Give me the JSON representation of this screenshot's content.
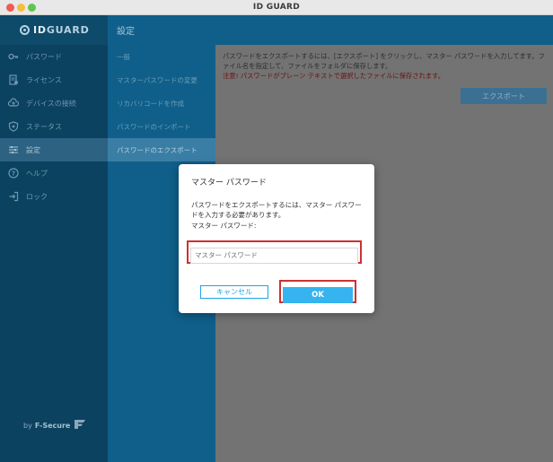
{
  "window": {
    "title": "ID GUARD"
  },
  "logo": {
    "id": "ID",
    "text": "GUARD"
  },
  "sidebar": {
    "items": [
      {
        "label": "パスワード",
        "icon": "key-icon"
      },
      {
        "label": "ライセンス",
        "icon": "license-icon"
      },
      {
        "label": "デバイスの接続",
        "icon": "cloud-upload-icon"
      },
      {
        "label": "ステータス",
        "icon": "shield-icon"
      },
      {
        "label": "設定",
        "icon": "sliders-icon"
      },
      {
        "label": "ヘルプ",
        "icon": "help-icon"
      },
      {
        "label": "ロック",
        "icon": "lock-exit-icon"
      }
    ],
    "active_index": 4,
    "brand_by": "by",
    "brand_name": "F-Secure"
  },
  "subpanel": {
    "header": "設定",
    "items": [
      "一般",
      "マスターパスワードの変更",
      "リカバリコードを作成",
      "パスワードのインポート",
      "パスワードのエクスポート"
    ],
    "active_index": 4
  },
  "content": {
    "description": "パスワードをエクスポートするには、[エクスポート] をクリックし、マスター パスワードを入力してます。ファイル名を指定して、ファイルをフォルダに保存します。",
    "warning": "注意! パスワードがプレーン テキストで選択したファイルに保存されます。",
    "export_label": "エクスポート"
  },
  "dialog": {
    "title": "マスター パスワード",
    "message": "パスワードをエクスポートするには、マスター パスワードを入力する必要があります。",
    "field_label": "マスター パスワード:",
    "placeholder": "マスター パスワード",
    "cancel_label": "キャンセル",
    "ok_label": "OK"
  },
  "colors": {
    "highlight": "#cf3030",
    "accent": "#35b4ef"
  }
}
